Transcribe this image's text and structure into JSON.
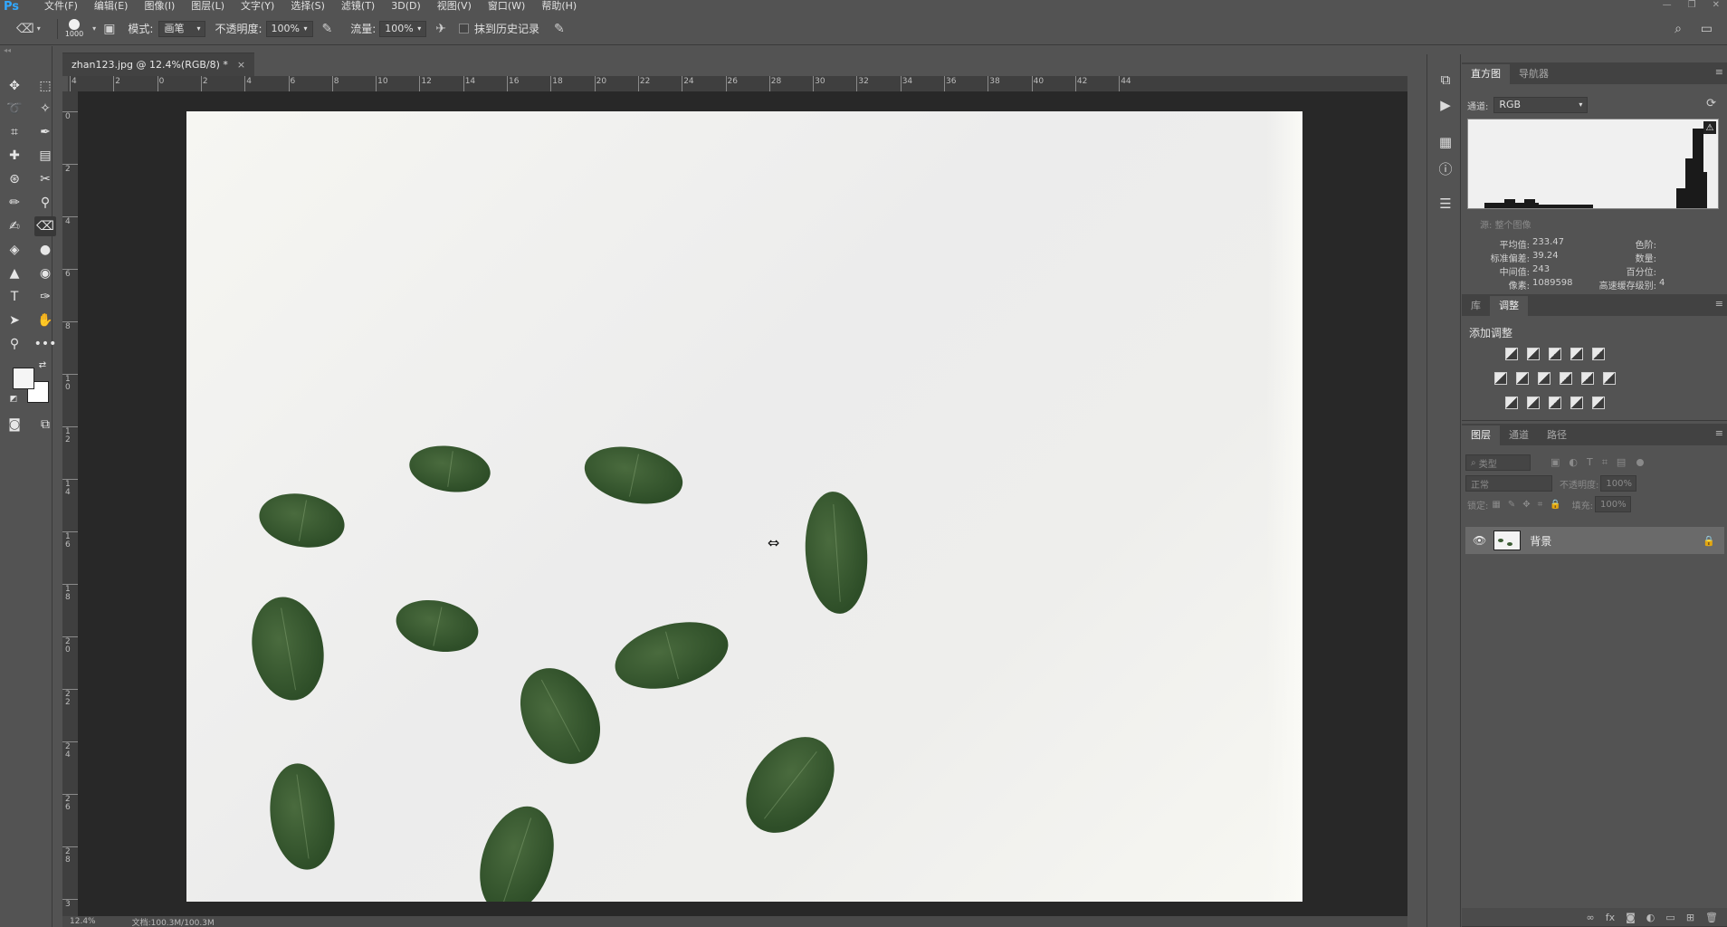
{
  "app": {
    "logo": "Ps"
  },
  "menu": [
    "文件(F)",
    "编辑(E)",
    "图像(I)",
    "图层(L)",
    "文字(Y)",
    "选择(S)",
    "滤镜(T)",
    "3D(D)",
    "视图(V)",
    "窗口(W)",
    "帮助(H)"
  ],
  "options": {
    "brush_size": "1000",
    "mode_label": "模式:",
    "mode_value": "画笔",
    "opacity_label": "不透明度:",
    "opacity_value": "100%",
    "flow_label": "流量:",
    "flow_value": "100%",
    "erase_history_label": "抹到历史记录"
  },
  "document": {
    "tab_title": "zhan123.jpg @ 12.4%(RGB/8) *",
    "close_glyph": "×",
    "zoom": "12.4%",
    "doc_info": "文档:100.3M/100.3M"
  },
  "rulers": {
    "top": [
      "4",
      "2",
      "0",
      "2",
      "4",
      "6",
      "8",
      "10",
      "12",
      "14",
      "16",
      "18",
      "20",
      "22",
      "24",
      "26",
      "28",
      "30",
      "32",
      "34",
      "36",
      "38",
      "40",
      "42",
      "44"
    ],
    "left": [
      "0",
      "2",
      "4",
      "6",
      "8",
      "1 0",
      "1 2",
      "1 4",
      "1 6",
      "1 8",
      "2 0",
      "2 2",
      "2 4",
      "2 6",
      "2 8",
      "3"
    ]
  },
  "histogram": {
    "tabs": [
      "直方图",
      "导航器"
    ],
    "channel_label": "通道:",
    "channel_value": "RGB",
    "source_label": "源:",
    "source_value": "整个图像",
    "stats_left": [
      {
        "label": "平均值:",
        "value": "233.47"
      },
      {
        "label": "标准偏差:",
        "value": "39.24"
      },
      {
        "label": "中间值:",
        "value": "243"
      },
      {
        "label": "像素:",
        "value": "1089598"
      }
    ],
    "stats_right": [
      {
        "label": "色阶:",
        "value": ""
      },
      {
        "label": "数量:",
        "value": ""
      },
      {
        "label": "百分位:",
        "value": ""
      },
      {
        "label": "高速缓存级别:",
        "value": "4"
      }
    ]
  },
  "adjustments": {
    "tabs": [
      "库",
      "调整"
    ],
    "add_label": "添加调整"
  },
  "layers": {
    "tabs": [
      "图层",
      "通道",
      "路径"
    ],
    "filter_placeholder": "类型",
    "blend_mode": "正常",
    "opacity_label": "不透明度:",
    "opacity_value": "100%",
    "lock_label": "锁定:",
    "fill_label": "填充:",
    "fill_value": "100%",
    "items": [
      {
        "name": "背景",
        "visible": true,
        "locked": true
      }
    ]
  },
  "colors": {
    "accent": "#31a8ff",
    "panel_bg": "#535353",
    "dark_bg": "#282828",
    "leaf": "#3a5c32"
  }
}
